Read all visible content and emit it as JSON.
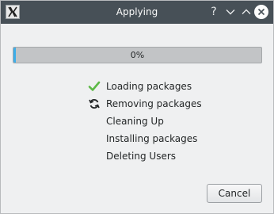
{
  "window": {
    "title": "Applying",
    "buttons": {
      "help": "?",
      "minimize": "⌄",
      "maximize": "⌃"
    }
  },
  "progress": {
    "value_percent": 0,
    "text": "0%",
    "fill_color": "#3daee9"
  },
  "steps": [
    {
      "label": "Loading packages",
      "status": "done",
      "icon": "checkmark-icon"
    },
    {
      "label": "Removing packages",
      "status": "in-progress",
      "icon": "refresh-icon"
    },
    {
      "label": "Cleaning Up",
      "status": "pending",
      "icon": ""
    },
    {
      "label": "Installing packages",
      "status": "pending",
      "icon": ""
    },
    {
      "label": "Deleting Users",
      "status": "pending",
      "icon": ""
    }
  ],
  "footer": {
    "cancel_label": "Cancel"
  },
  "colors": {
    "titlebar": "#475057",
    "check": "#5cb946"
  }
}
